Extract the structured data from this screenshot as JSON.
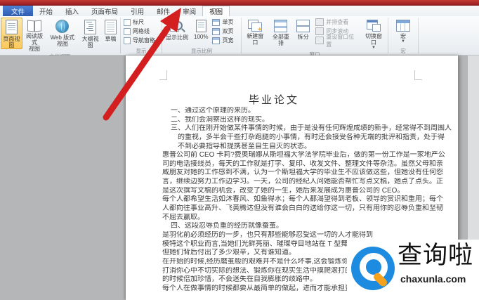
{
  "colors": {
    "titlebar_red": "#a32125",
    "file_tab_blue": "#2d5bb0",
    "selected_button_orange": "#fbc85c",
    "arrow_red": "#d31f1f",
    "workspace_gray": "#b4b6b8",
    "logo_blue": "#1d8ce0",
    "logo_orange": "#f6a21d"
  },
  "ribbon": {
    "tabs": [
      {
        "id": "file",
        "label": "文件",
        "file": true
      },
      {
        "id": "home",
        "label": "开始"
      },
      {
        "id": "insert",
        "label": "插入"
      },
      {
        "id": "page-layout",
        "label": "页面布局"
      },
      {
        "id": "references",
        "label": "引用"
      },
      {
        "id": "mailings",
        "label": "邮件"
      },
      {
        "id": "review",
        "label": "审阅"
      },
      {
        "id": "view",
        "label": "视图",
        "selected": true
      }
    ],
    "groups": {
      "document_views": {
        "label": "文档视图",
        "buttons": [
          {
            "id": "print-layout",
            "label": "页面视图",
            "icon": "ico-doc",
            "selected": true
          },
          {
            "id": "full-screen-reading",
            "label": "阅读版式\n视图",
            "icon": "ico-book"
          },
          {
            "id": "web-layout",
            "label": "Web 版式视图",
            "icon": "ico-globe"
          },
          {
            "id": "outline",
            "label": "大纲视图",
            "icon": "ico-outline"
          },
          {
            "id": "draft",
            "label": "草稿",
            "icon": "ico-draft"
          }
        ]
      },
      "show": {
        "label": "显示",
        "checkboxes": [
          {
            "id": "ruler",
            "label": "标尺",
            "checked": false
          },
          {
            "id": "gridlines",
            "label": "网格线",
            "checked": false
          },
          {
            "id": "navigation-pane",
            "label": "导航窗格",
            "checked": false
          }
        ]
      },
      "zoom": {
        "label": "显示比例",
        "zoom_button": "显示比例",
        "hundred_button": "100%",
        "small_buttons": [
          {
            "id": "one-page",
            "label": "单页"
          },
          {
            "id": "two-pages",
            "label": "双页"
          },
          {
            "id": "page-width",
            "label": "页宽"
          }
        ]
      },
      "window": {
        "label": "窗口",
        "big_buttons": [
          {
            "id": "new-window",
            "label": "新建窗口",
            "icon": "ico-newwin"
          },
          {
            "id": "arrange-all",
            "label": "全部重排",
            "icon": "ico-arrange"
          },
          {
            "id": "split",
            "label": "拆分",
            "icon": "ico-split"
          }
        ],
        "small_buttons": [
          {
            "id": "view-side-by-side",
            "label": "并排查看"
          },
          {
            "id": "synchronous-scrolling",
            "label": "同步滚动"
          },
          {
            "id": "reset-window-position",
            "label": "重设窗口位置"
          }
        ],
        "switch_label": "切换窗口"
      },
      "macros": {
        "label": "宏",
        "button_label": "宏"
      }
    }
  },
  "document": {
    "title": "毕业论文",
    "lines": [
      {
        "indent": 1,
        "text": "一、通过这个原理的来历。"
      },
      {
        "indent": 1,
        "text": "二、我们会洞察出这样的现实。"
      },
      {
        "indent": 1,
        "text": "三、人们在刚开始做某件事情的时候，由于是没有任何辉煌成绩的新手，经常得不到周围人"
      },
      {
        "indent": 2,
        "text": "的重视，多半会干些打杂跑腿的小事情，有时还会接受各种无端的批评和指责，处于得"
      },
      {
        "indent": 2,
        "text": "不到必要指导和提携甚至自生自灭的状态。"
      },
      {
        "indent": 0,
        "text": "惠普公司前 CEO 卡莉?费奥瑞娜从斯坦福大学法学院毕业后，做的第一份工作是一家地产公"
      },
      {
        "indent": 0,
        "text": "司的电话接线员，每天的工作就是打字、复印、收发文件、整理文件等杂活。虽然父母和亲"
      },
      {
        "indent": 0,
        "text": "威朋友对她的工作感到不满，认为一个斯坦福大学的毕业生不应该做这些，但她没有任何怨"
      },
      {
        "indent": 0,
        "text": "言，继续边努力工作边学习。一天，公司的经纪人问她能否帮忙写点文稿，她点了点头。正"
      },
      {
        "indent": 0,
        "text": "是这次撰写文稿的机会，改变了她的一生，她后来发展成为惠普公司的 CEO。"
      },
      {
        "indent": 0,
        "text": "每个人都希望生活如沐春风、如鱼得水；每个人都渴望得到老板、领导的赏识和重用；每个"
      },
      {
        "indent": 0,
        "text": "人都向往事业高升、飞黄腾达但没有谁会白白的送给你这一切，只有用你的忍辱负重和坚韧"
      },
      {
        "indent": 0,
        "text": "不屈去赢取。"
      },
      {
        "indent": 1,
        "text": "四、这段忍辱负重的经历就像蚕茧。"
      },
      {
        "indent": 0,
        "text": "是羽化前必须经历的一步，也只有那些能够忍受这一切的人才能得到"
      },
      {
        "indent": 0,
        "text": "模特这个职业而言,当她们光鲜亮丽、璀璨夺目地站在 T 型舞台上时"
      },
      {
        "indent": 0,
        "text": "但她们背后付出了多少艰辛，又有谁知道。"
      },
      {
        "indent": 0,
        "text": "在开始的时候,经历磨茧般的艰难并不是什么坏事,这会锻炼你的"
      },
      {
        "indent": 0,
        "text": "打消你心中不切实际的想法、锻炼你在现实生活中摸爬滚打的能力，"
      },
      {
        "indent": 0,
        "text": "的时候倍加珍惜，不会迷失在自我膨胀的歧路中。"
      },
      {
        "indent": 0,
        "text": "每个人在做事情的时候都要从最简单的做起，进而才能承担更重要的使命。这是一条必经之"
      }
    ]
  },
  "watermark": {
    "brand": "查询啦",
    "domain": "chaxunla.com"
  }
}
